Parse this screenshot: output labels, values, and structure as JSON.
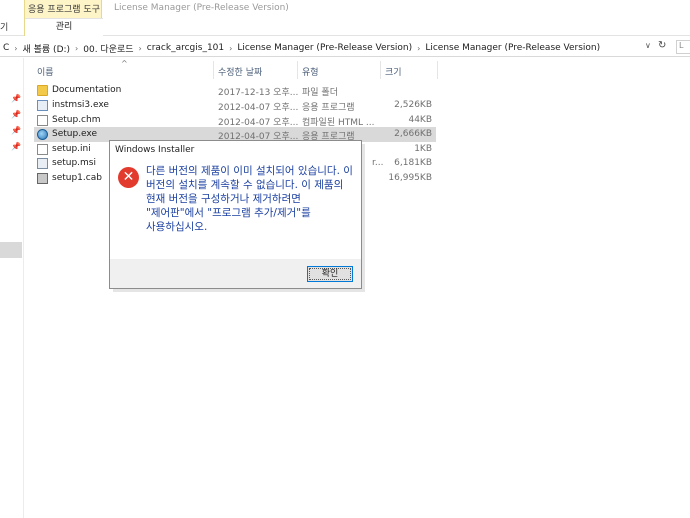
{
  "ribbon": {
    "left_fragment": "기",
    "context_group_title": "응용 프로그램 도구",
    "context_tab": "관리",
    "window_title": "License Manager (Pre-Release Version)"
  },
  "address": {
    "crumbs": [
      "C",
      "새 볼륨 (D:)",
      "00. 다운로드",
      "crack_arcgis_101",
      "License Manager (Pre-Release Version)",
      "License Manager (Pre-Release Version)"
    ],
    "separator": "›",
    "dropdown": "∨",
    "refresh": "↻",
    "search_fragment": "L"
  },
  "columns": {
    "name": "이름",
    "date": "수정한 날짜",
    "type": "유형",
    "size": "크기"
  },
  "files": [
    {
      "name": "Documentation",
      "date": "2017-12-13 오후...",
      "type": "파일 폴더",
      "size": "",
      "icon": "folder-icon"
    },
    {
      "name": "instmsi3.exe",
      "date": "2012-04-07 오후...",
      "type": "응용 프로그램",
      "size": "2,526KB",
      "icon": "exe-icon"
    },
    {
      "name": "Setup.chm",
      "date": "2012-04-07 오후...",
      "type": "컴파일된 HTML ...",
      "size": "44KB",
      "icon": "chm-icon"
    },
    {
      "name": "Setup.exe",
      "date": "2012-04-07 오후...",
      "type": "응용 프로그램",
      "size": "2,666KB",
      "icon": "setup-icon"
    },
    {
      "name": "setup.ini",
      "date": "",
      "type": "",
      "size": "1KB",
      "icon": "ini-icon"
    },
    {
      "name": "setup.msi",
      "date": "",
      "type": "r...",
      "size": "6,181KB",
      "icon": "msi-icon"
    },
    {
      "name": "setup1.cab",
      "date": "",
      "type": "",
      "size": "16,995KB",
      "icon": "cab-icon"
    }
  ],
  "dialog": {
    "title": "Windows Installer",
    "icon": "error-icon",
    "icon_glyph": "✕",
    "message": "다른 버전의 제품이 이미 설치되어 있습니다. 이 버전의 설치를 계속할 수 없습니다. 이 제품의 현재 버전을 구성하거나 제거하려면 \"제어판\"에서 \"프로그램 추가/제거\"를 사용하십시오.",
    "ok_label": "확인"
  },
  "colors": {
    "context_tab_bg": "#fdf5c8",
    "selection_bg": "#d9d9d9",
    "dialog_text": "#1a3fa0",
    "error_red": "#e23b2e",
    "button_focus": "#0078d7"
  }
}
